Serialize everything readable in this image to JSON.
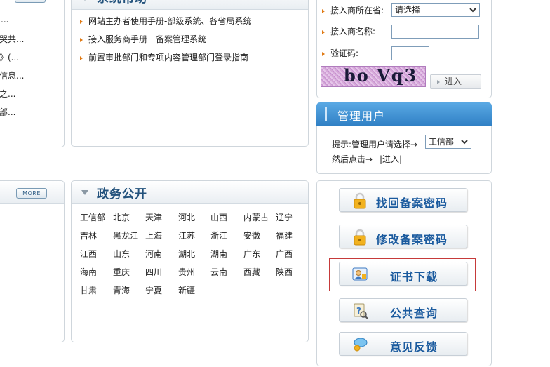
{
  "left_fragments_top": [
    "...",
    "哭共...",
    "》(...",
    "信息...",
    "之...",
    "部..."
  ],
  "system_panel": {
    "title": "系统帮助",
    "links": [
      "网站主办者使用手册-部级系统、各省局系统",
      "接入服务商手册一备案管理系统",
      "前置审批部门和专项内容管理部门登录指南"
    ]
  },
  "more_label": "MORE",
  "gov_panel": {
    "title": "政务公开",
    "provinces": [
      [
        "工信部",
        "北京",
        "天津",
        "河北",
        "山西",
        "内蒙古",
        "辽宁"
      ],
      [
        "吉林",
        "黑龙江",
        "上海",
        "江苏",
        "浙江",
        "安徽",
        "福建"
      ],
      [
        "江西",
        "山东",
        "河南",
        "湖北",
        "湖南",
        "广东",
        "广西"
      ],
      [
        "海南",
        "重庆",
        "四川",
        "贵州",
        "云南",
        "西藏",
        "陕西"
      ],
      [
        "甘肃",
        "青海",
        "宁夏",
        "新疆"
      ]
    ]
  },
  "login_form": {
    "province_label": "接入商所在省:",
    "province_value": "请选择",
    "name_label": "接入商名称:",
    "code_label": "验证码:",
    "captcha_text": "bo Vq3",
    "enter_label": "进入"
  },
  "admin": {
    "title": "管理用户",
    "hint": "提示:管理用户请选择→",
    "select_value": "工信部",
    "then": "然后点击→",
    "enter_link": "|进入|"
  },
  "actions": [
    {
      "label": "找回备案密码",
      "icon": "lock-icon"
    },
    {
      "label": "修改备案密码",
      "icon": "lock-icon"
    },
    {
      "label": "证书下载",
      "icon": "certificate-user-icon"
    },
    {
      "label": "公共查询",
      "icon": "query-icon"
    },
    {
      "label": "意见反馈",
      "icon": "feedback-icon"
    }
  ]
}
